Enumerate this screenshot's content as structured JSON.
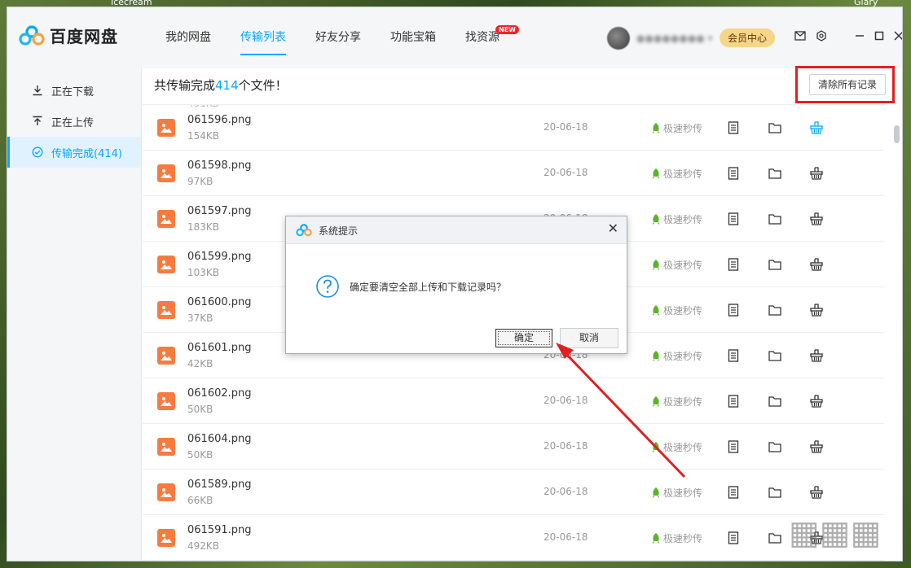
{
  "desktop": {
    "left_label": "Icecream",
    "right_label": "Glary"
  },
  "app": {
    "logo_text": "百度网盘",
    "nav": [
      {
        "label": "我的网盘",
        "active": false
      },
      {
        "label": "传输列表",
        "active": true
      },
      {
        "label": "好友分享",
        "active": false
      },
      {
        "label": "功能宝箱",
        "active": false
      },
      {
        "label": "找资源",
        "active": false,
        "badge": "NEW"
      }
    ],
    "vip_label": "会员中心",
    "accent": "#06a7ff"
  },
  "sidebar": {
    "items": [
      {
        "label": "正在下载",
        "icon": "download-icon"
      },
      {
        "label": "正在上传",
        "icon": "upload-icon"
      },
      {
        "label": "传输完成(414)",
        "icon": "check-circle-icon",
        "active": true
      }
    ]
  },
  "main": {
    "summary_prefix": "共传输完成",
    "summary_count": "414",
    "summary_suffix": "个文件！",
    "clear_button": "清除所有记录",
    "fast_label": "极速秒传",
    "files": [
      {
        "name": "061596.png",
        "size": "154KB",
        "date": "20-06-18"
      },
      {
        "name": "061598.png",
        "size": "97KB",
        "date": "20-06-18"
      },
      {
        "name": "061597.png",
        "size": "183KB",
        "date": "20-06-18"
      },
      {
        "name": "061599.png",
        "size": "103KB",
        "date": "20-06-18"
      },
      {
        "name": "061600.png",
        "size": "37KB",
        "date": "20-06-18"
      },
      {
        "name": "061601.png",
        "size": "42KB",
        "date": "20-06-18"
      },
      {
        "name": "061602.png",
        "size": "50KB",
        "date": "20-06-18"
      },
      {
        "name": "061604.png",
        "size": "50KB",
        "date": "20-06-18"
      },
      {
        "name": "061589.png",
        "size": "66KB",
        "date": "20-06-18"
      },
      {
        "name": "061591.png",
        "size": "492KB",
        "date": "20-06-18"
      }
    ]
  },
  "dialog": {
    "title": "系统提示",
    "message": "确定要清空全部上传和下载记录吗？",
    "ok": "确定",
    "cancel": "取消"
  }
}
